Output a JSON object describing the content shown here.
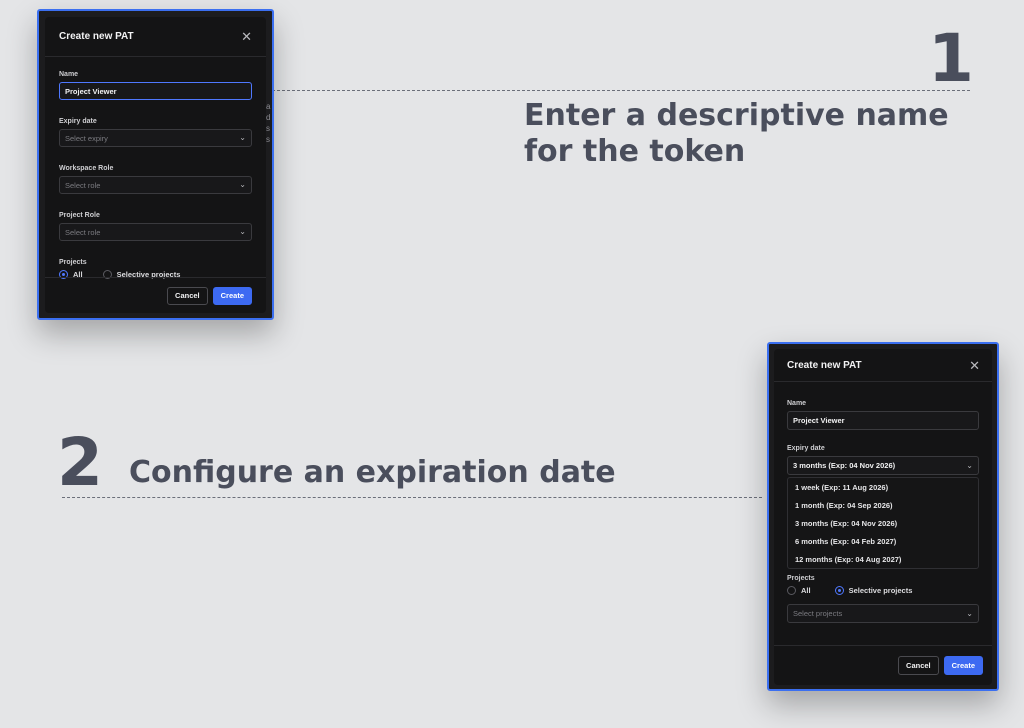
{
  "callouts": {
    "step1": {
      "number": "1",
      "text": "Enter a descriptive name for the token"
    },
    "step2": {
      "number": "2",
      "text": "Configure an expiration date"
    }
  },
  "colors": {
    "background": "#e4e5e7",
    "callout_text": "#4a4e5c",
    "frame_accent": "#3b6ff0",
    "modal_bg": "#141415",
    "primary_button": "#3d6af2"
  },
  "modal1": {
    "title": "Create new PAT",
    "close_icon": "close-icon",
    "name_label": "Name",
    "name_value": "Project Viewer",
    "expiry_label": "Expiry date",
    "expiry_placeholder": "Select expiry",
    "workspace_role_label": "Workspace Role",
    "workspace_role_placeholder": "Select role",
    "project_role_label": "Project Role",
    "project_role_placeholder": "Select role",
    "projects_label": "Projects",
    "projects_options": {
      "all": "All",
      "selective": "Selective projects"
    },
    "projects_selected": "all",
    "cancel_label": "Cancel",
    "create_label": "Create",
    "background_peek": [
      "a",
      "d",
      "s",
      "s"
    ]
  },
  "modal2": {
    "title": "Create new PAT",
    "close_icon": "close-icon",
    "name_label": "Name",
    "name_value": "Project Viewer",
    "expiry_label": "Expiry date",
    "expiry_value": "3 months (Exp: 04 Nov 2026)",
    "expiry_options": [
      "1 week (Exp: 11 Aug 2026)",
      "1 month (Exp: 04 Sep 2026)",
      "3 months (Exp: 04 Nov 2026)",
      "6 months (Exp: 04 Feb 2027)",
      "12 months (Exp: 04 Aug 2027)"
    ],
    "projects_label": "Projects",
    "projects_options": {
      "all": "All",
      "selective": "Selective projects"
    },
    "projects_selected": "selective",
    "select_projects_placeholder": "Select projects",
    "cancel_label": "Cancel",
    "create_label": "Create"
  }
}
